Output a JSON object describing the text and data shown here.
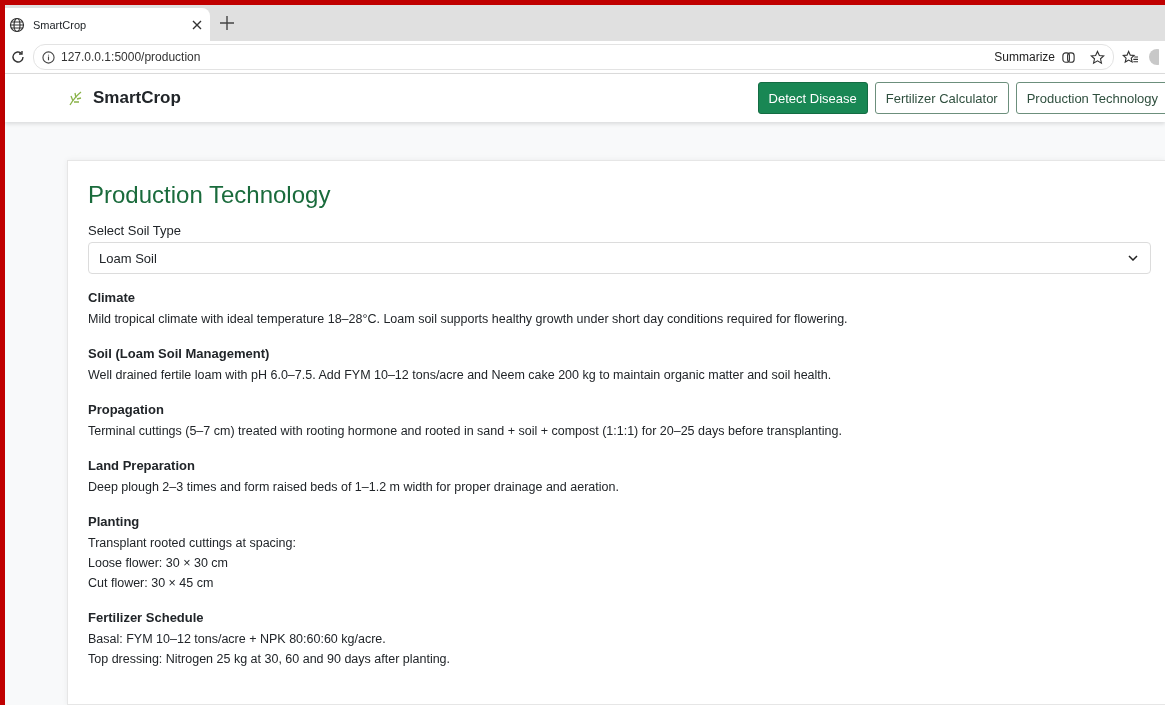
{
  "browser": {
    "tab_title": "SmartCrop",
    "url": "127.0.0.1:5000/production",
    "summarize": "Summarize"
  },
  "navbar": {
    "brand": "SmartCrop",
    "links": [
      {
        "label": "Detect Disease",
        "selected": true
      },
      {
        "label": "Fertilizer Calculator",
        "selected": false
      },
      {
        "label": "Production Technology",
        "selected": false
      }
    ]
  },
  "page": {
    "title": "Production Technology",
    "select_label": "Select Soil Type",
    "select_value": "Loam Soil",
    "sections": [
      {
        "heading": "Climate",
        "lines": [
          "Mild tropical climate with ideal temperature 18–28°C. Loam soil supports healthy growth under short day conditions required for flowering."
        ]
      },
      {
        "heading": "Soil (Loam Soil Management)",
        "lines": [
          "Well drained fertile loam with pH 6.0–7.5. Add FYM 10–12 tons/acre and Neem cake 200 kg to maintain organic matter and soil health."
        ]
      },
      {
        "heading": "Propagation",
        "lines": [
          "Terminal cuttings (5–7 cm) treated with rooting hormone and rooted in sand + soil + compost (1:1:1) for 20–25 days before transplanting."
        ]
      },
      {
        "heading": "Land Preparation",
        "lines": [
          "Deep plough 2–3 times and form raised beds of 1–1.2 m width for proper drainage and aeration."
        ]
      },
      {
        "heading": "Planting",
        "lines": [
          "Transplant rooted cuttings at spacing:",
          "Loose flower: 30 × 30 cm",
          "Cut flower: 30 × 45 cm"
        ]
      },
      {
        "heading": "Fertilizer Schedule",
        "lines": [
          "Basal: FYM 10–12 tons/acre + NPK 80:60:60 kg/acre.",
          "Top dressing: Nitrogen 25 kg at 30, 60 and 90 days after planting."
        ]
      }
    ]
  }
}
